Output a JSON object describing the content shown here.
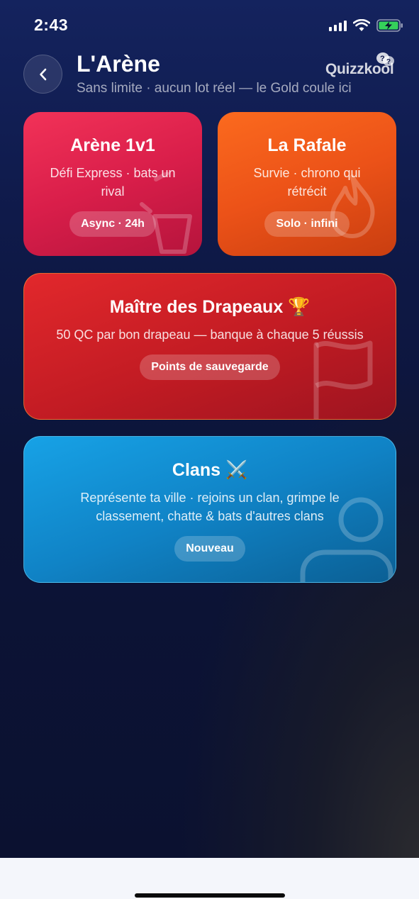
{
  "status_bar": {
    "time": "2:43"
  },
  "header": {
    "title": "L'Arène",
    "subtitle": "Sans limite · aucun lot réel — le Gold coule ici",
    "logo_text": "Quizzkool"
  },
  "cards": [
    {
      "title": "Arène 1v1",
      "description": "Défi Express · bats un rival",
      "badge": "Async · 24h",
      "icon": "battle-cup-icon",
      "color": "#e02450"
    },
    {
      "title": "La Rafale",
      "description": "Survie · chrono qui rétrécit",
      "badge": "Solo · infini",
      "icon": "flame-icon",
      "color": "#f15a1c"
    },
    {
      "title": "Maître des Drapeaux 🏆",
      "description": "50 QC par bon drapeau — banque à chaque 5 réussis",
      "badge": "Points de sauvegarde",
      "icon": "flag-icon",
      "color": "#c81e26"
    },
    {
      "title": "Clans ⚔️",
      "description": "Représente ta ville · rejoins un clan, grimpe le classement, chatte & bats d'autres clans",
      "badge": "Nouveau",
      "icon": "users-icon",
      "color": "#1392d8"
    }
  ]
}
